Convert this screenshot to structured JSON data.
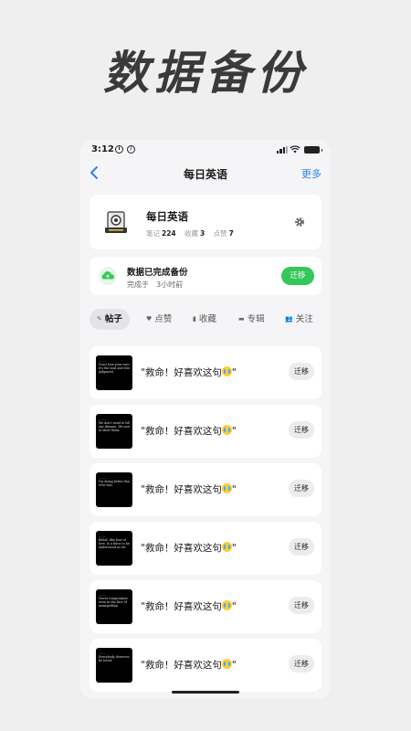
{
  "promo_title": "数据备份",
  "status": {
    "time": "3:12"
  },
  "nav": {
    "title": "每日英语",
    "more": "更多"
  },
  "profile": {
    "name": "每日英语",
    "notes_label": "笔记",
    "notes_count": "224",
    "fav_label": "收藏",
    "fav_count": "3",
    "likes_label": "点赞",
    "likes_count": "7"
  },
  "backup": {
    "title": "数据已完成备份",
    "sub_label": "完成于",
    "sub_time": "3小时前",
    "migrate_label": "迁移"
  },
  "tabs": [
    {
      "label": "帖子",
      "icon": "✎"
    },
    {
      "label": "点赞",
      "icon": "♥"
    },
    {
      "label": "收藏",
      "icon": "▮"
    },
    {
      "label": "专辑",
      "icon": "▬"
    },
    {
      "label": "关注",
      "icon": "👥"
    }
  ],
  "posts": [
    {
      "title": "\"救命！好喜欢这句",
      "title_end": "\"",
      "migrate": "迁移",
      "thumb": [
        "Don't lose your voice,",
        "it's the soul and strongest",
        "judgment."
      ]
    },
    {
      "title": "\"救命！好喜欢这句",
      "title_end": "\"",
      "migrate": "迁移",
      "thumb": [
        "We don't need to tell",
        "our dreams. We need",
        "to show them."
      ]
    },
    {
      "title": "\"救命！好喜欢这句",
      "title_end": "\"",
      "migrate": "迁移",
      "thumb": [
        "I'm doing better than I",
        "ever was."
      ]
    },
    {
      "title": "\"救命！好喜欢这句",
      "title_end": "\"",
      "migrate": "迁移",
      "thumb": [
        "Belief, like fear or",
        "love, is a force to be",
        "understood as we"
      ]
    },
    {
      "title": "\"救命！好喜欢这句",
      "title_end": "\"",
      "migrate": "迁移",
      "thumb": [
        "Never compromise. Not",
        "even in the face of",
        "armageddon."
      ]
    },
    {
      "title": "\"救命！好喜欢这句",
      "title_end": "\"",
      "migrate": "迁移",
      "thumb": [
        "Everybody deserves to",
        "be loved."
      ]
    }
  ]
}
